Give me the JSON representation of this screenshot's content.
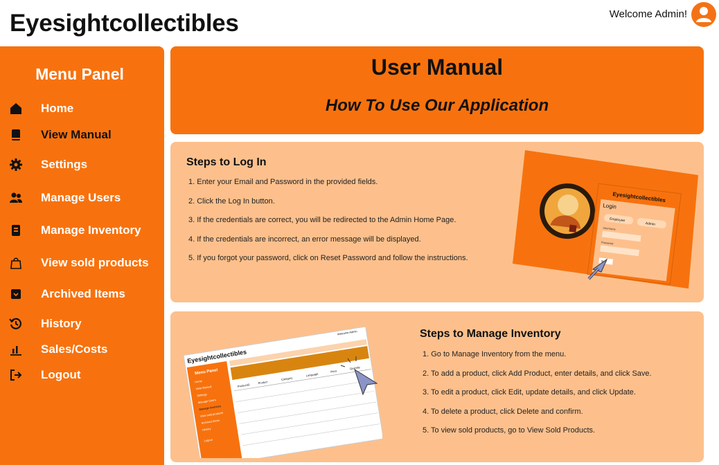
{
  "app": {
    "brand": "Eyesightcollectibles",
    "welcome": "Welcome Admin!"
  },
  "sidebar": {
    "title": "Menu Panel",
    "items": [
      {
        "label": "Home",
        "icon": "home-icon"
      },
      {
        "label": "View Manual",
        "icon": "book-icon"
      },
      {
        "label": "Settings",
        "icon": "gear-icon"
      },
      {
        "label": "Manage Users",
        "icon": "users-icon"
      },
      {
        "label": "Manage Inventory",
        "icon": "inventory-icon"
      },
      {
        "label": "View sold products",
        "icon": "shopping-bag-icon"
      },
      {
        "label": "Archived Items",
        "icon": "archive-icon"
      },
      {
        "label": "History",
        "icon": "history-icon"
      },
      {
        "label": "Sales/Costs",
        "icon": "bar-chart-icon"
      },
      {
        "label": "Logout",
        "icon": "logout-icon"
      }
    ]
  },
  "header": {
    "title": "User Manual",
    "subtitle": "How To Use Our Application"
  },
  "login_section": {
    "title": "Steps to Log In",
    "steps": [
      "1. Enter your Email and Password in the provided fields.",
      "2. Click the Log In button.",
      "3. If the credentials are correct, you will be redirected to the Admin Home Page.",
      "4. If the credentials are incorrect, an error message will be displayed.",
      "5. If you forgot your password, click on Reset Password and follow the instructions."
    ],
    "preview": {
      "brand": "Eyesightcollectibles",
      "login": "Login",
      "employee": "Employee",
      "admin": "Admin",
      "username": "Username",
      "password": "Password",
      "button": "Sign"
    }
  },
  "inventory_section": {
    "title": "Steps to Manage Inventory",
    "steps": [
      "1. Go to Manage Inventory from the menu.",
      "2. To add a product, click Add Product, enter details, and click Save.",
      "3. To edit a product, click Edit, update details, and click Update.",
      "4. To delete a product, click Delete and confirm.",
      "5. To view sold products, go to View Sold Products."
    ],
    "preview": {
      "brand": "Eyesightcollectibles",
      "menu": "Menu Panel",
      "welcome": "Welcome Admin",
      "items": [
        "Home",
        "View Manual",
        "Settings",
        "Manage Users",
        "Manage Inventory",
        "View sold products",
        "Archived Items",
        "History",
        "Logout"
      ],
      "columns": [
        "ProductID",
        "Product",
        "Category",
        "Language",
        "Price",
        "Quantity"
      ]
    }
  },
  "colors": {
    "accent": "#f7720e",
    "card": "#fdc08c",
    "text": "#111111"
  }
}
